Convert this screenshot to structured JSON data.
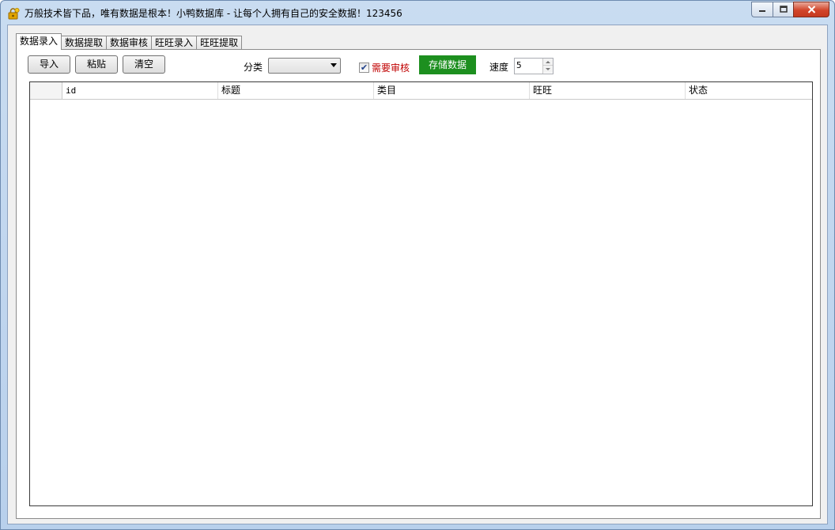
{
  "window": {
    "title": "万般技术皆下品，唯有数据是根本！小鸭数据库 - 让每个人拥有自己的安全数据！123456",
    "app_icon": "duck-lock-icon"
  },
  "tabs": [
    {
      "label": "数据录入",
      "active": true
    },
    {
      "label": "数据提取",
      "active": false
    },
    {
      "label": "数据审核",
      "active": false
    },
    {
      "label": "旺旺录入",
      "active": false
    },
    {
      "label": "旺旺提取",
      "active": false
    }
  ],
  "toolbar": {
    "import_label": "导入",
    "paste_label": "粘贴",
    "clear_label": "清空",
    "category_label": "分类",
    "category_value": "",
    "need_review_label": "需要审核",
    "need_review_checked": true,
    "save_label": "存储数据",
    "speed_label": "速度",
    "speed_value": "5"
  },
  "grid": {
    "columns": [
      "id",
      "标题",
      "类目",
      "旺旺",
      "状态"
    ],
    "rows": []
  },
  "colors": {
    "save_button": "#1d8f1f",
    "need_review_text": "#c00000",
    "close_button": "#d2452a"
  }
}
